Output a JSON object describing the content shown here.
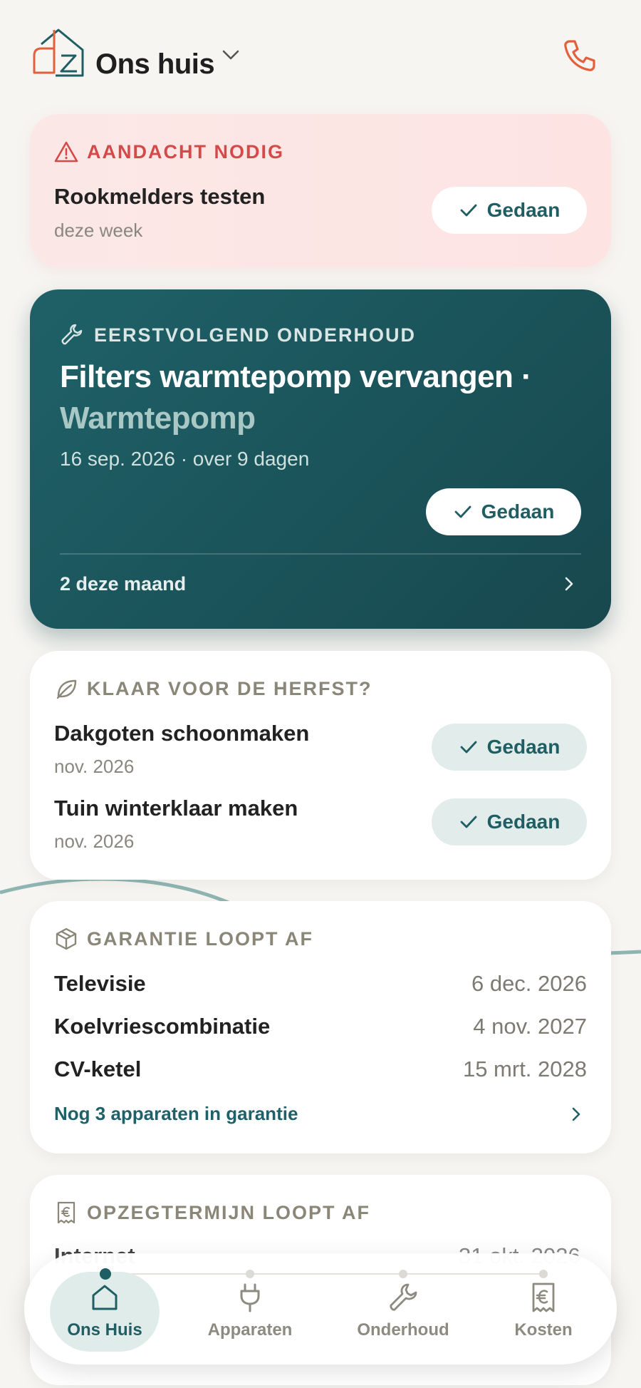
{
  "header": {
    "title": "Ons huis",
    "logo_text": "dz"
  },
  "alert": {
    "eyebrow": "AANDACHT NODIG",
    "task_title": "Rookmelders testen",
    "task_when": "deze week",
    "done_label": "Gedaan"
  },
  "next_maintenance": {
    "eyebrow": "EERSTVOLGEND ONDERHOUD",
    "title": "Filters warmtepomp vervangen ·",
    "device": "Warmtepomp",
    "date_line": "16 sep. 2026 · over 9 dagen",
    "done_label": "Gedaan",
    "footer": "2 deze maand"
  },
  "autumn": {
    "eyebrow": "KLAAR VOOR DE HERFST?",
    "items": [
      {
        "title": "Dakgoten schoonmaken",
        "date": "nov. 2026",
        "done_label": "Gedaan"
      },
      {
        "title": "Tuin winterklaar maken",
        "date": "nov. 2026",
        "done_label": "Gedaan"
      }
    ]
  },
  "warranty": {
    "eyebrow": "GARANTIE LOOPT AF",
    "items": [
      {
        "name": "Televisie",
        "date": "6 dec. 2026"
      },
      {
        "name": "Koelvriescombinatie",
        "date": "4 nov. 2027"
      },
      {
        "name": "CV-ketel",
        "date": "15 mrt. 2028"
      }
    ],
    "more_link": "Nog 3 apparaten in garantie"
  },
  "notice": {
    "eyebrow": "OPZEGTERMIJN LOOPT AF",
    "peek_name": "Internet",
    "peek_date": "31 okt. 2026"
  },
  "nav": {
    "items": [
      {
        "label": "Ons Huis",
        "icon": "home-icon",
        "active": true
      },
      {
        "label": "Apparaten",
        "icon": "plug-icon",
        "active": false
      },
      {
        "label": "Onderhoud",
        "icon": "wrench-icon",
        "active": false
      },
      {
        "label": "Kosten",
        "icon": "receipt-euro-icon",
        "active": false
      }
    ]
  },
  "colors": {
    "background": "#f6f5f2",
    "accent_teal": "#1f5e63",
    "alert_red": "#d44a4a",
    "alert_bg": "#fbe8e6",
    "phone_orange": "#e2603c"
  }
}
